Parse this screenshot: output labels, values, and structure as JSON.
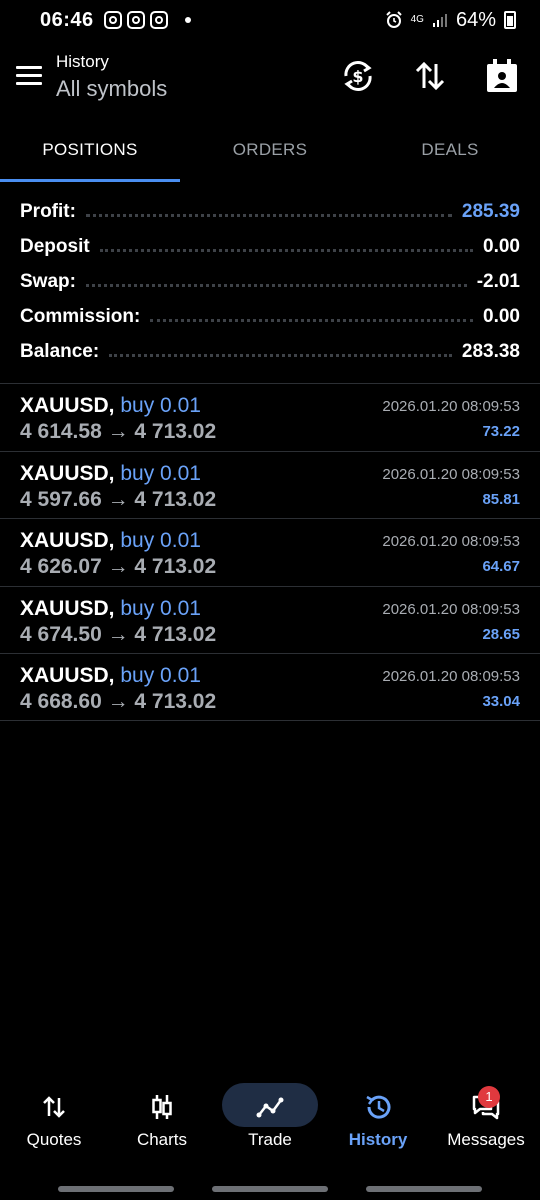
{
  "status_bar": {
    "time": "06:46",
    "network": "4G",
    "battery": "64%"
  },
  "header": {
    "title": "History",
    "subtitle": "All symbols"
  },
  "tabs": [
    {
      "label": "POSITIONS",
      "active": true
    },
    {
      "label": "ORDERS",
      "active": false
    },
    {
      "label": "DEALS",
      "active": false
    }
  ],
  "summary": {
    "profit_label": "Profit:",
    "profit_value": "285.39",
    "deposit_label": "Deposit",
    "deposit_value": "0.00",
    "swap_label": "Swap:",
    "swap_value": "-2.01",
    "commission_label": "Commission:",
    "commission_value": "0.00",
    "balance_label": "Balance:",
    "balance_value": "283.38"
  },
  "positions": [
    {
      "symbol": "XAUUSD,",
      "type": "buy 0.01",
      "prices": "4 614.58 → 4 713.02",
      "time": "2026.01.20 08:09:53",
      "profit": "73.22"
    },
    {
      "symbol": "XAUUSD,",
      "type": "buy 0.01",
      "prices": "4 597.66 → 4 713.02",
      "time": "2026.01.20 08:09:53",
      "profit": "85.81"
    },
    {
      "symbol": "XAUUSD,",
      "type": "buy 0.01",
      "prices": "4 626.07 → 4 713.02",
      "time": "2026.01.20 08:09:53",
      "profit": "64.67"
    },
    {
      "symbol": "XAUUSD,",
      "type": "buy 0.01",
      "prices": "4 674.50 → 4 713.02",
      "time": "2026.01.20 08:09:53",
      "profit": "28.65"
    },
    {
      "symbol": "XAUUSD,",
      "type": "buy 0.01",
      "prices": "4 668.60 → 4 713.02",
      "time": "2026.01.20 08:09:53",
      "profit": "33.04"
    }
  ],
  "bottom_nav": [
    {
      "label": "Quotes",
      "icon": "quotes-icon"
    },
    {
      "label": "Charts",
      "icon": "charts-icon"
    },
    {
      "label": "Trade",
      "icon": "trade-icon"
    },
    {
      "label": "History",
      "icon": "history-icon",
      "active": true
    },
    {
      "label": "Messages",
      "icon": "messages-icon"
    }
  ],
  "messages_badge": "1",
  "colors": {
    "accent": "#4a8ef0",
    "positive": "#6aa2f8",
    "background": "#000000",
    "badge": "#e0393e"
  }
}
